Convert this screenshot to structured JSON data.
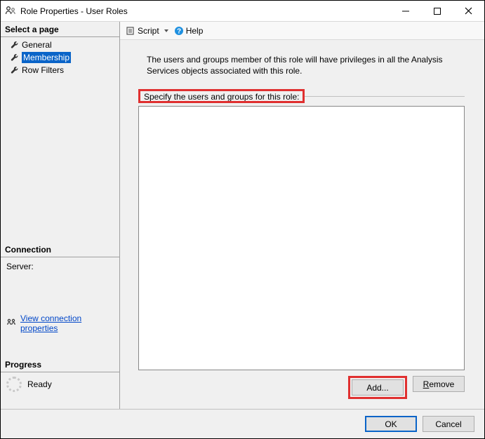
{
  "window": {
    "title": "Role Properties - User Roles"
  },
  "sidebar": {
    "select_page_label": "Select a page",
    "pages": [
      {
        "label": "General"
      },
      {
        "label": "Membership"
      },
      {
        "label": "Row Filters"
      }
    ],
    "connection_label": "Connection",
    "server_label": "Server:",
    "view_conn_link": "View connection properties",
    "progress_label": "Progress",
    "ready_label": "Ready"
  },
  "toolbar": {
    "script_label": "Script",
    "help_label": "Help"
  },
  "main": {
    "description": "The users and groups member of this role will have privileges in all the Analysis Services objects associated with this role.",
    "group_label": "Specify the users and groups for this role:",
    "add_label": "Add...",
    "remove_label": "Remove"
  },
  "footer": {
    "ok_label": "OK",
    "cancel_label": "Cancel"
  }
}
